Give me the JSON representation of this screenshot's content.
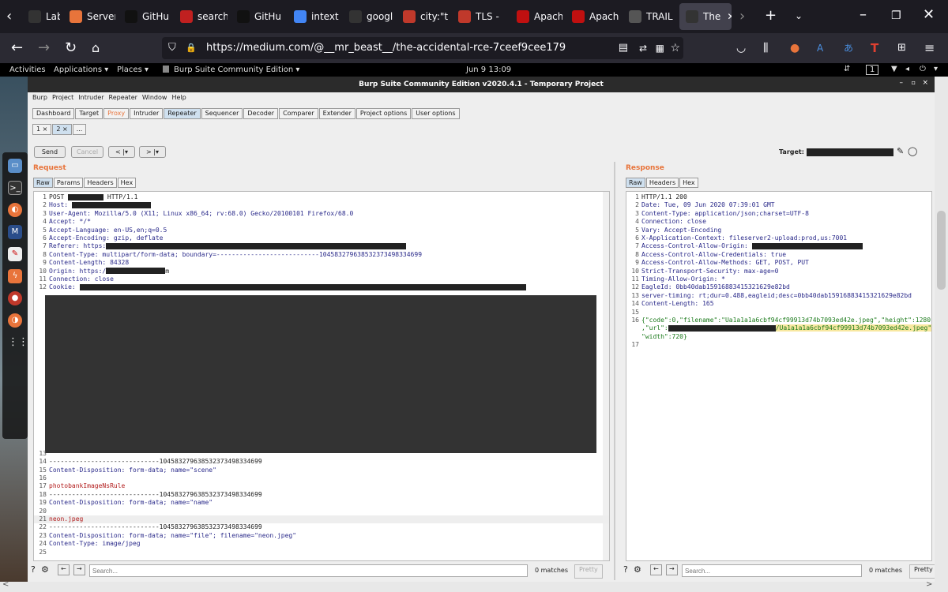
{
  "browser": {
    "tabs": [
      {
        "label": "Lab: F",
        "icon": "lab-icon",
        "color": "#333"
      },
      {
        "label": "Server",
        "icon": "lightning-icon",
        "color": "#e8743b"
      },
      {
        "label": "GitHu",
        "icon": "github-icon",
        "color": "#111"
      },
      {
        "label": "search",
        "icon": "search-icon",
        "color": "#c02020"
      },
      {
        "label": "GitHu",
        "icon": "github-icon",
        "color": "#111"
      },
      {
        "label": "intext",
        "icon": "google-icon",
        "color": "#4285f4"
      },
      {
        "label": "google.co",
        "icon": "page-icon",
        "color": "#333"
      },
      {
        "label": "city:\"t",
        "icon": "shodan-icon",
        "color": "#c0392b"
      },
      {
        "label": "TLS -",
        "icon": "shodan-icon",
        "color": "#c0392b"
      },
      {
        "label": "Apach",
        "icon": "j-icon",
        "color": "#c01010"
      },
      {
        "label": "Apach",
        "icon": "feather-icon",
        "color": "#c01010"
      },
      {
        "label": "TRAIL",
        "icon": "t-icon",
        "color": "#555"
      },
      {
        "label": "The",
        "icon": "medium-icon",
        "color": "#333"
      }
    ],
    "active_tab": 12,
    "url": "https://medium.com/@__mr_beast__/the-accidental-rce-7ceef9cee179"
  },
  "gnome": {
    "activities": "Activities",
    "applications": "Applications ▾",
    "places": "Places ▾",
    "app": "Burp Suite Community Edition ▾",
    "clock": "Jun 9  13:09",
    "workspace": "1"
  },
  "burp": {
    "title": "Burp Suite Community Edition v2020.4.1 - Temporary Project",
    "menu": [
      "Burp",
      "Project",
      "Intruder",
      "Repeater",
      "Window",
      "Help"
    ],
    "tabs": [
      "Dashboard",
      "Target",
      "Proxy",
      "Intruder",
      "Repeater",
      "Sequencer",
      "Decoder",
      "Comparer",
      "Extender",
      "Project options",
      "User options"
    ],
    "subtabs": [
      "1 ×",
      "2 ×",
      "..."
    ],
    "send": "Send",
    "cancel": "Cancel",
    "back": "< |▾",
    "fwd": "> |▾",
    "target_label": "Target:",
    "request_label": "Request",
    "response_label": "Response",
    "req_tabs": [
      "Raw",
      "Params",
      "Headers",
      "Hex"
    ],
    "resp_tabs": [
      "Raw",
      "Headers",
      "Hex"
    ],
    "search_placeholder": "Search...",
    "matches": "0 matches",
    "pretty": "Pretty"
  },
  "request_lines": [
    {
      "n": "1",
      "t": "POST ",
      "r": 45,
      "a": " HTTP/1.1"
    },
    {
      "n": "2",
      "t": "Host: ",
      "r": 100,
      "a": ""
    },
    {
      "n": "3",
      "t": "User-Agent: Mozilla/5.0 (X11; Linux x86_64; rv:68.0) Gecko/20100101 Firefox/68.0",
      "r": 0,
      "a": ""
    },
    {
      "n": "4",
      "t": "Accept: */*",
      "r": 0,
      "a": ""
    },
    {
      "n": "5",
      "t": "Accept-Language: en-US,en;q=0.5",
      "r": 0,
      "a": ""
    },
    {
      "n": "6",
      "t": "Accept-Encoding: gzip, deflate",
      "r": 0,
      "a": ""
    },
    {
      "n": "7",
      "t": "Referer: https:",
      "r": 380,
      "a": ""
    },
    {
      "n": "8",
      "t": "Content-Type: multipart/form-data; boundary=---------------------------104583279638532373498334699",
      "r": 0,
      "a": ""
    },
    {
      "n": "9",
      "t": "Content-Length: 84328",
      "r": 0,
      "a": ""
    },
    {
      "n": "10",
      "t": "Origin: https:/",
      "r": 75,
      "a": "m"
    },
    {
      "n": "11",
      "t": "Connection: close",
      "r": 0,
      "a": ""
    },
    {
      "n": "12",
      "t": "Cookie: ",
      "r": 565,
      "a": ""
    },
    {
      "n": "13",
      "t": "",
      "r": 0,
      "a": ""
    },
    {
      "n": "14",
      "t": "-----------------------------104583279638532373498334699",
      "r": 0,
      "a": ""
    },
    {
      "n": "15",
      "t": "Content-Disposition: form-data; name=\"scene\"",
      "r": 0,
      "a": ""
    },
    {
      "n": "16",
      "t": "",
      "r": 0,
      "a": ""
    },
    {
      "n": "17",
      "t": "photobankImageNsRule",
      "r": 0,
      "a": ""
    },
    {
      "n": "18",
      "t": "-----------------------------104583279638532373498334699",
      "r": 0,
      "a": ""
    },
    {
      "n": "19",
      "t": "Content-Disposition: form-data; name=\"name\"",
      "r": 0,
      "a": ""
    },
    {
      "n": "20",
      "t": "",
      "r": 0,
      "a": ""
    },
    {
      "n": "21",
      "t": "neon.jpeg",
      "r": 0,
      "a": ""
    },
    {
      "n": "22",
      "t": "-----------------------------104583279638532373498334699",
      "r": 0,
      "a": ""
    },
    {
      "n": "23",
      "t": "Content-Disposition: form-data; name=\"file\"; filename=\"neon.jpeg\"",
      "r": 0,
      "a": ""
    },
    {
      "n": "24",
      "t": "Content-Type: image/jpeg",
      "r": 0,
      "a": ""
    },
    {
      "n": "25",
      "t": "",
      "r": 0,
      "a": ""
    }
  ],
  "response_lines": [
    {
      "n": "1",
      "t": "HTTP/1.1 200"
    },
    {
      "n": "2",
      "t": "Date: Tue, 09 Jun 2020 07:39:01 GMT"
    },
    {
      "n": "3",
      "t": "Content-Type: application/json;charset=UTF-8"
    },
    {
      "n": "4",
      "t": "Connection: close"
    },
    {
      "n": "5",
      "t": "Vary: Accept-Encoding"
    },
    {
      "n": "6",
      "t": "X-Application-Context: fileserver2-upload:prod,us:7001"
    },
    {
      "n": "7",
      "t": "Access-Control-Allow-Origin: "
    },
    {
      "n": "8",
      "t": "Access-Control-Allow-Credentials: true"
    },
    {
      "n": "9",
      "t": "Access-Control-Allow-Methods: GET, POST, PUT"
    },
    {
      "n": "10",
      "t": "Strict-Transport-Security: max-age=0"
    },
    {
      "n": "11",
      "t": "Timing-Allow-Origin: *"
    },
    {
      "n": "12",
      "t": "EagleId: 0bb40dab15916883415321629e82bd"
    },
    {
      "n": "13",
      "t": "server-timing: rt;dur=0.488,eagleid;desc=0bb40dab15916883415321629e82bd"
    },
    {
      "n": "14",
      "t": "Content-Length: 165"
    },
    {
      "n": "15",
      "t": ""
    },
    {
      "n": "16",
      "t": "{\"code\":0,\"filename\":\"Ua1a1a1a6cbf94cf99913d74b7093ed42e.jpeg\",\"height\":1280"
    },
    {
      "n": "",
      "t": ",\"url\":"
    },
    {
      "n": "",
      "t": "\"width\":720}"
    },
    {
      "n": "17",
      "t": ""
    }
  ],
  "response_url_suffix": "/Ua1a1a1a6cbf94cf99913d74b7093ed42e.jpeg\","
}
